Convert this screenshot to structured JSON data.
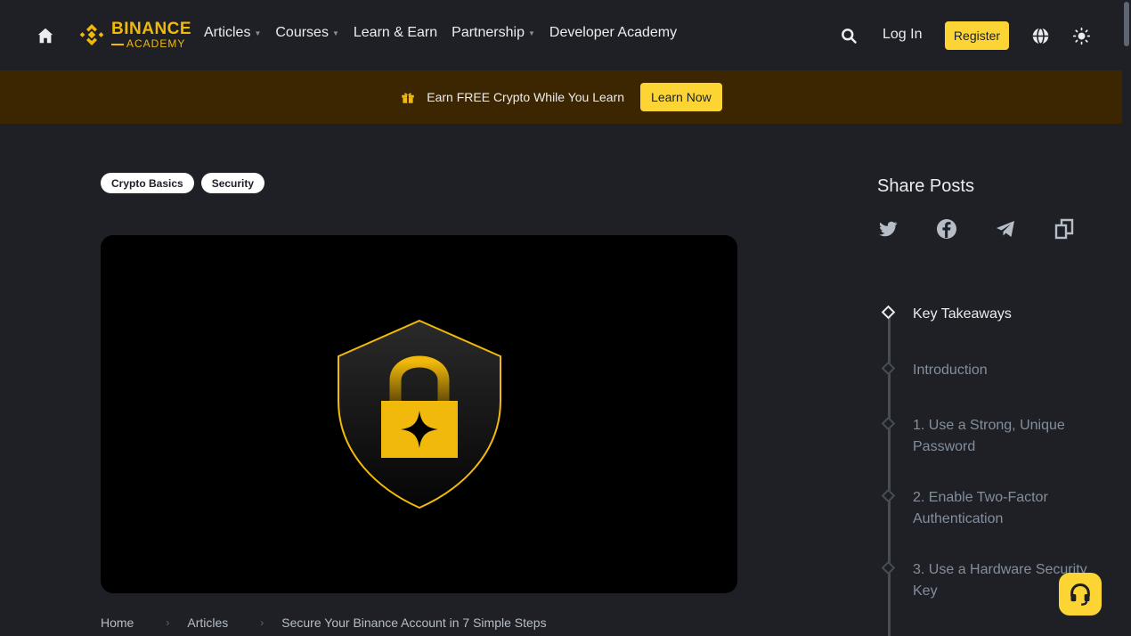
{
  "nav": {
    "logo_top": "BINANCE",
    "logo_bottom": "ACADEMY",
    "items": [
      {
        "label": "Articles",
        "has_caret": true
      },
      {
        "label": "Courses",
        "has_caret": true
      },
      {
        "label": "Learn & Earn",
        "has_caret": false
      },
      {
        "label": "Partnership",
        "has_caret": true
      },
      {
        "label": "Developer Academy",
        "has_caret": false
      }
    ],
    "login": "Log In",
    "register": "Register"
  },
  "banner": {
    "text": "Earn FREE Crypto While You Learn",
    "cta": "Learn Now"
  },
  "tags": [
    "Crypto Basics",
    "Security"
  ],
  "breadcrumb": {
    "home": "Home",
    "articles": "Articles",
    "current": "Secure Your Binance Account in 7 Simple Steps"
  },
  "share": {
    "title": "Share Posts",
    "icons": [
      "twitter-icon",
      "facebook-icon",
      "telegram-icon",
      "copy-link-icon"
    ]
  },
  "toc": {
    "items": [
      {
        "label": "Key Takeaways",
        "active": true
      },
      {
        "label": "Introduction",
        "active": false
      },
      {
        "label": "1. Use a Strong, Unique Password",
        "active": false
      },
      {
        "label": "2. Enable Two-Factor Authentication",
        "active": false
      },
      {
        "label": "3. Use a Hardware Security Key",
        "active": false
      }
    ]
  },
  "colors": {
    "accent": "#fcd535",
    "brand": "#f0b90b",
    "background": "#1e2026",
    "banner": "#3c2601"
  }
}
